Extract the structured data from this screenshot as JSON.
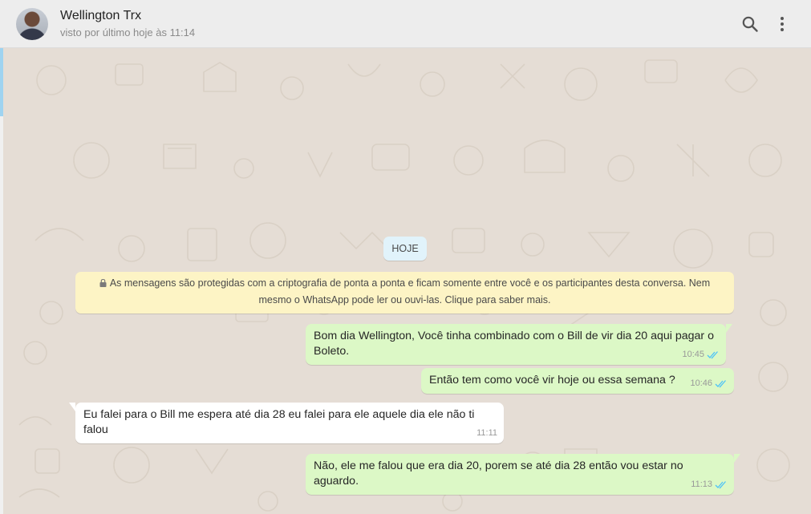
{
  "header": {
    "contact_name": "Wellington Trx",
    "status": "visto por último hoje às 11:14",
    "icons": [
      "search-icon",
      "menu-dots-icon"
    ]
  },
  "chat": {
    "day_label": "HOJE",
    "encryption_notice_line1": "As mensagens são protegidas com a criptografia de ponta a ponta e ficam somente entre você e os participantes desta conversa. Nem",
    "encryption_notice_line2": "mesmo o WhatsApp pode ler ou ouvi-las. Clique para saber mais.",
    "messages": [
      {
        "direction": "out",
        "line1": "Bom dia Wellington, Você tinha combinado com o Bill de vir dia 20 aqui pagar o",
        "line2": "Boleto.",
        "time": "10:45",
        "status": "read"
      },
      {
        "direction": "out",
        "line1": "Então tem como você vir hoje ou essa semana ?",
        "time": "10:46",
        "status": "read"
      },
      {
        "direction": "in",
        "line1": "Eu falei para o Bill me espera até dia 28 eu falei para ele aquele dia ele não ti falou",
        "time": "11:11"
      },
      {
        "direction": "out",
        "line1": "Não, ele me falou que era dia 20, porem se até dia 28 então vou estar no aguardo.",
        "time": "11:13",
        "status": "read"
      }
    ]
  },
  "colors": {
    "outgoing_bubble": "#dcf8c6",
    "incoming_bubble": "#ffffff",
    "chat_background": "#e5ddd5",
    "read_ticks": "#4fc3f7",
    "notice_background": "#fdf4c5",
    "day_chip_background": "#e1f3fb"
  }
}
